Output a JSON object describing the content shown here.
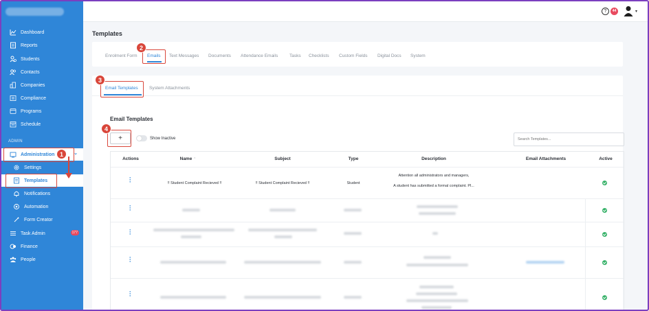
{
  "sidebar": {
    "items": [
      {
        "label": "Dashboard",
        "icon": "chart-icon"
      },
      {
        "label": "Reports",
        "icon": "report-icon"
      },
      {
        "label": "Students",
        "icon": "students-icon"
      },
      {
        "label": "Contacts",
        "icon": "contacts-icon"
      },
      {
        "label": "Companies",
        "icon": "companies-icon"
      },
      {
        "label": "Compliance",
        "icon": "compliance-icon"
      },
      {
        "label": "Programs",
        "icon": "programs-icon"
      },
      {
        "label": "Schedule",
        "icon": "schedule-icon"
      }
    ],
    "section_admin": "ADMIN",
    "administration": "Administration",
    "admin_subitems": [
      {
        "label": "Settings",
        "icon": "gear-icon"
      },
      {
        "label": "Templates",
        "icon": "template-icon"
      },
      {
        "label": "Notifications",
        "icon": "bell-icon"
      },
      {
        "label": "Automation",
        "icon": "automation-icon"
      },
      {
        "label": "Form Creator",
        "icon": "wand-icon"
      }
    ],
    "task_admin": "Task Admin",
    "task_admin_badge": "177",
    "finance": "Finance",
    "people": "People"
  },
  "topbar": {
    "help": "?",
    "notification_count": "44"
  },
  "page": {
    "title": "Templates",
    "tabs": [
      "Enrolment Form",
      "Emails",
      "Text Messages",
      "Documents",
      "Attendance Emails",
      "Tasks",
      "Checklists",
      "Custom Fields",
      "Digital Docs",
      "System"
    ],
    "subtabs": [
      "Email Templates",
      "System Attachments"
    ],
    "section_title": "Email Templates",
    "add_label": "+",
    "show_inactive": "Show Inactive",
    "search_placeholder": "Search Templates..."
  },
  "table": {
    "headers": [
      "Actions",
      "Name",
      "Subject",
      "Type",
      "Description",
      "Email Attachments",
      "Active"
    ],
    "sort_icon": "sort-icon",
    "first_row": {
      "name": "!! Student Complaint Recieved !!",
      "subject": "!! Student Complaint Recieved !!",
      "type": "Student",
      "description_line1": "Attention all administrators and managers,",
      "description_line2": "A student has submitted a formal complaint. Pl..."
    }
  },
  "annotations": [
    "1",
    "2",
    "3",
    "4"
  ],
  "colors": {
    "sidebar": "#2f86d8",
    "accent": "#2f86d8",
    "annotation": "#d9463a",
    "active_check": "#38b26a",
    "badge": "#e84a5f"
  }
}
